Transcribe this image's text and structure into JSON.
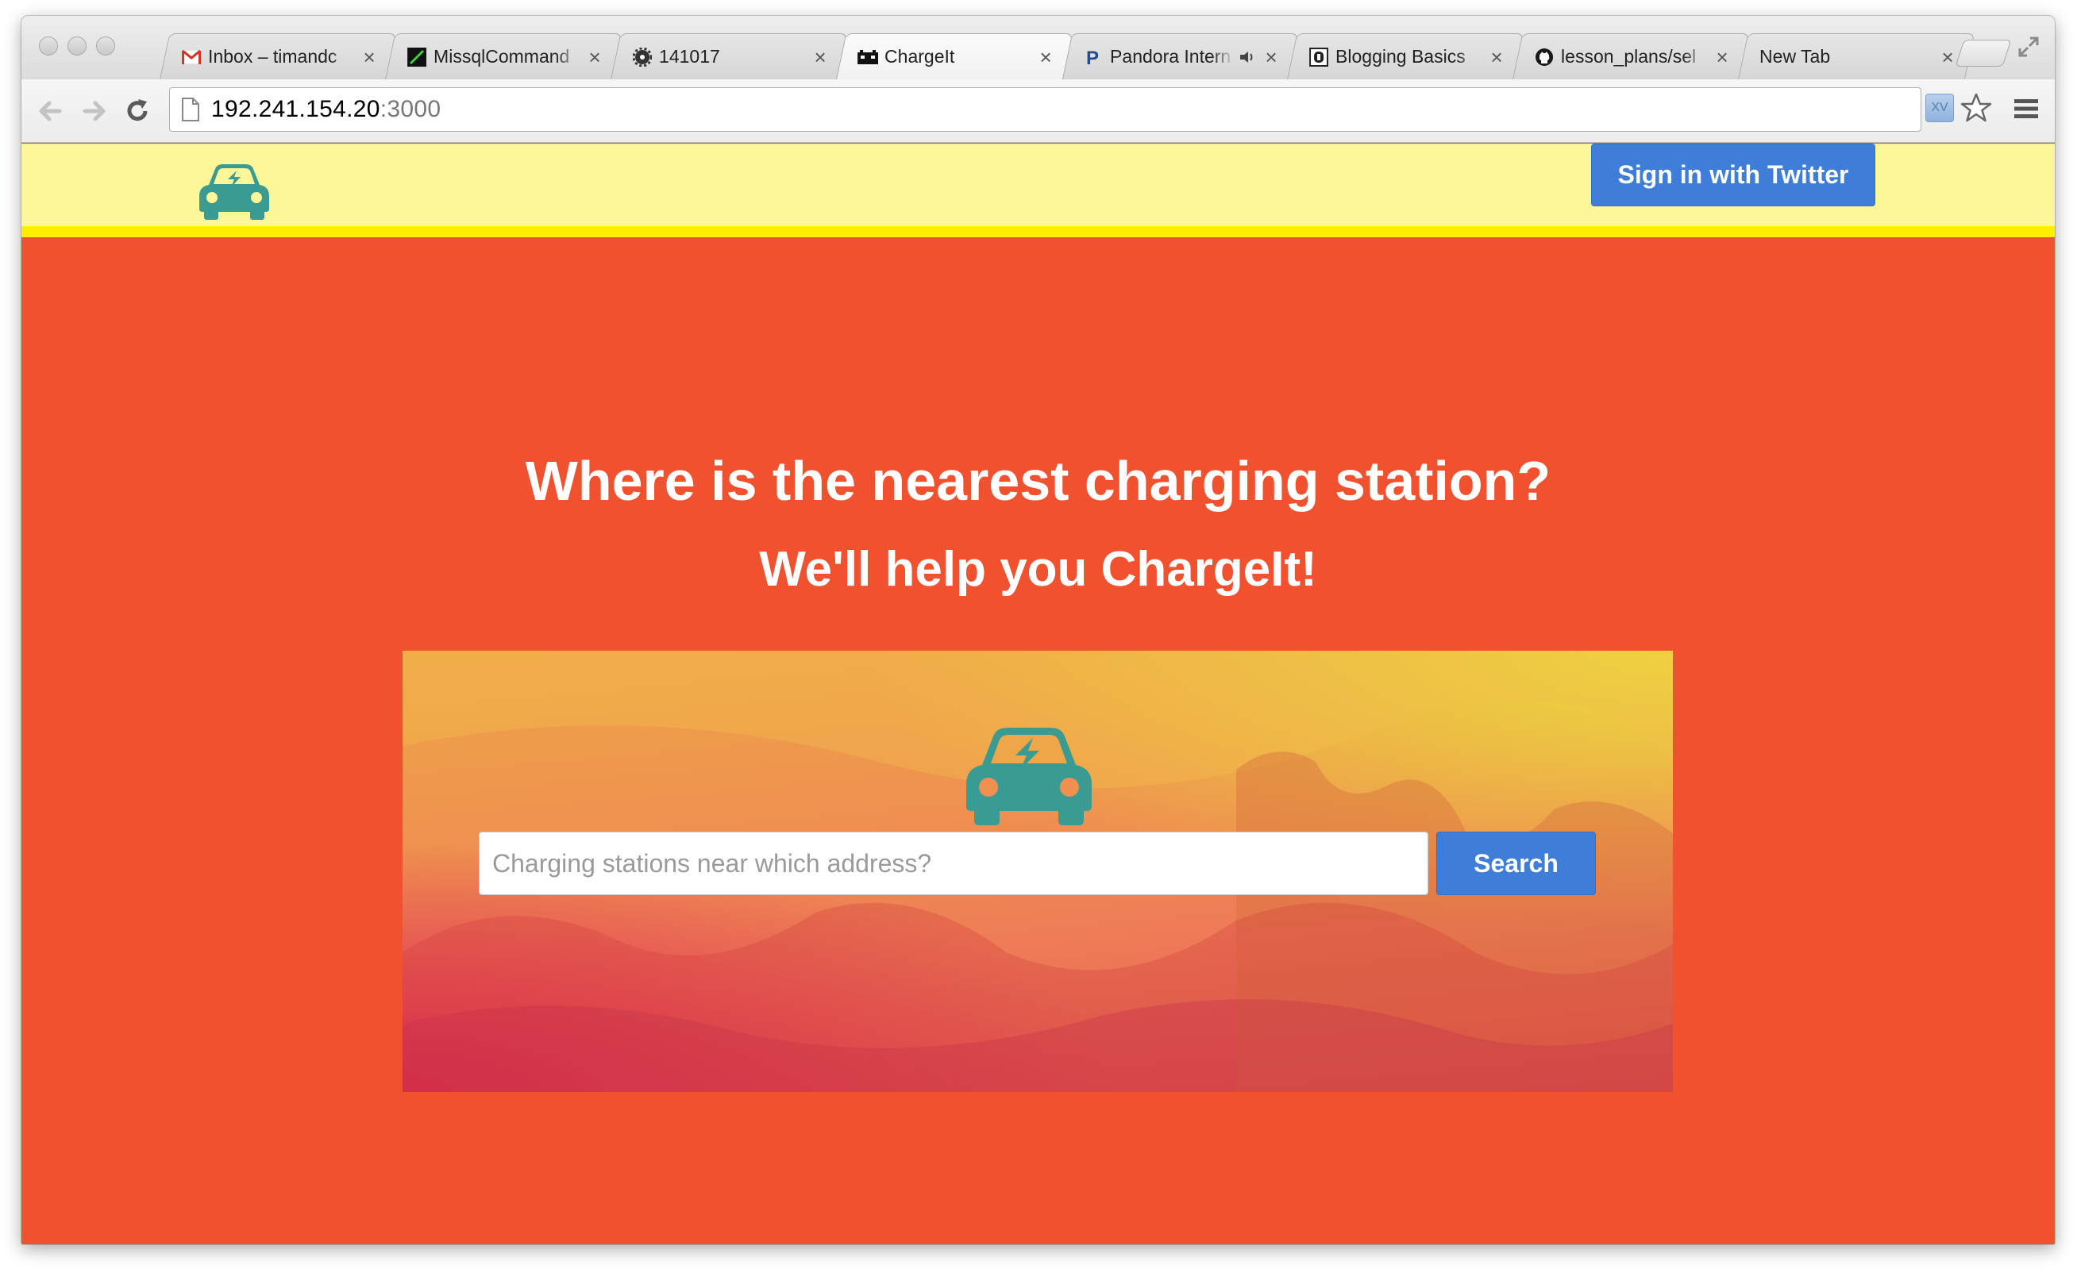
{
  "browser": {
    "tabs": [
      {
        "title": "Inbox – timandc",
        "icon": "gmail-icon"
      },
      {
        "title": "MissqlCommand",
        "icon": "terminal-icon"
      },
      {
        "title": "141017",
        "icon": "gear-icon"
      },
      {
        "title": "ChargeIt",
        "icon": "film-icon"
      },
      {
        "title": "Pandora Intern",
        "icon": "pandora-icon"
      },
      {
        "title": "Blogging Basics",
        "icon": "blog-icon"
      },
      {
        "title": "lesson_plans/sel",
        "icon": "github-icon"
      },
      {
        "title": "New Tab",
        "icon": ""
      }
    ],
    "active_tab_index": 3,
    "address": {
      "host": "192.241.154.20",
      "port": ":3000"
    },
    "extension_label": "XV"
  },
  "site": {
    "sign_in_label": "Sign in with Twitter",
    "headline": "Where is the nearest charging station?",
    "subheadline": "We'll help you ChargeIt!",
    "search": {
      "placeholder": "Charging stations near which address?",
      "value": ""
    },
    "search_button_label": "Search"
  },
  "colors": {
    "page_background": "#f05230",
    "header_background": "#fdf79a",
    "header_border": "#ffee00",
    "button_blue": "#3f7ed8",
    "logo_teal": "#3a9b93"
  }
}
